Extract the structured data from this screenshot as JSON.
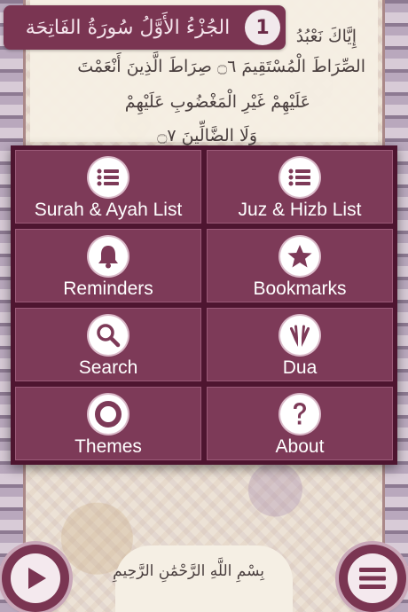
{
  "header": {
    "surah_title": "الجُزْءُ الأَوَّلُ سُورَةُ الفَاتِحَة",
    "juz_number": "1"
  },
  "page_text": {
    "line1": "إِيَّاكَ نَعْبُدُ",
    "line2": "الصِّرَاطَ الْمُسْتَقِيمَ ۝٦ صِرَاطَ الَّذِينَ أَنْعَمْتَ",
    "line3": "عَلَيْهِمْ غَيْرِ الْمَغْضُوبِ عَلَيْهِمْ",
    "line4": "وَلَا الضَّالِّينَ ۝٧",
    "bottom_line": "بِسْمِ اللَّهِ الرَّحْمَٰنِ الرَّحِيمِ"
  },
  "menu": {
    "items": [
      {
        "label": "Surah & Ayah List",
        "icon": "list-icon"
      },
      {
        "label": "Juz & Hizb List",
        "icon": "list-icon"
      },
      {
        "label": "Reminders",
        "icon": "bell-icon"
      },
      {
        "label": "Bookmarks",
        "icon": "star-icon"
      },
      {
        "label": "Search",
        "icon": "search-icon"
      },
      {
        "label": "Dua",
        "icon": "praying-hands-icon"
      },
      {
        "label": "Themes",
        "icon": "ring-icon"
      },
      {
        "label": "About",
        "icon": "question-icon"
      }
    ]
  },
  "controls": {
    "play_icon": "play-icon",
    "menu_icon": "hamburger-icon"
  },
  "colors": {
    "accent": "#7d3a58",
    "menu_background": "#4e1530",
    "page_background": "#ece2d6"
  }
}
